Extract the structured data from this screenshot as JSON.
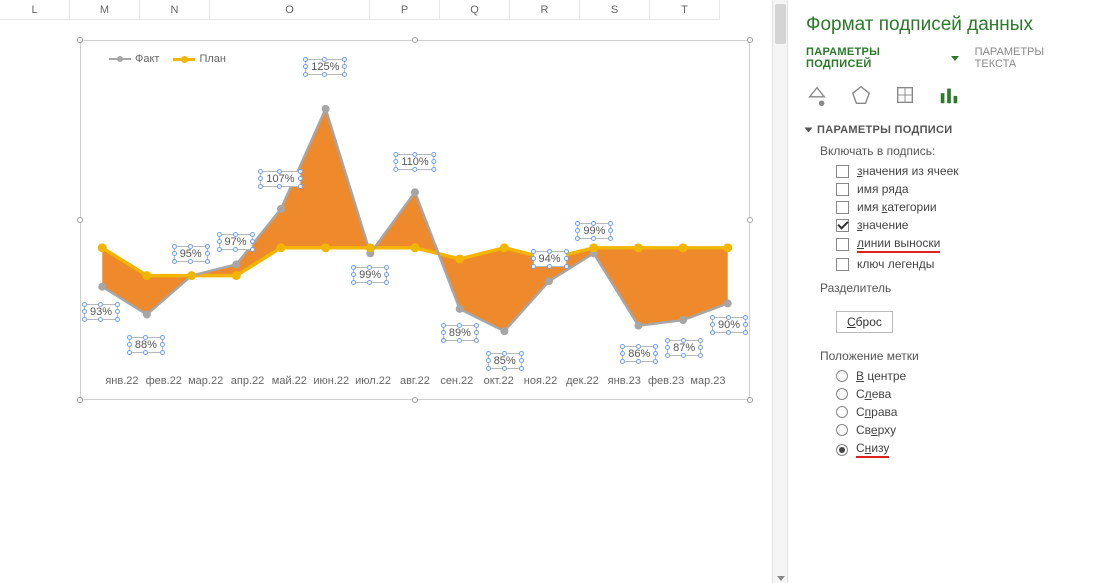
{
  "columns": [
    {
      "label": "L",
      "w": 70
    },
    {
      "label": "M",
      "w": 70
    },
    {
      "label": "N",
      "w": 70
    },
    {
      "label": "O",
      "w": 160
    },
    {
      "label": "P",
      "w": 70
    },
    {
      "label": "Q",
      "w": 70
    },
    {
      "label": "R",
      "w": 70
    },
    {
      "label": "S",
      "w": 70
    },
    {
      "label": "T",
      "w": 70
    }
  ],
  "chart_data": {
    "type": "line",
    "title": "",
    "ylabel": "",
    "xlabel": "",
    "categories": [
      "янв.22",
      "фев.22",
      "мар.22",
      "апр.22",
      "май.22",
      "июн.22",
      "июл.22",
      "авг.22",
      "сен.22",
      "окт.22",
      "ноя.22",
      "дек.22",
      "янв.23",
      "фев.23",
      "мар.23"
    ],
    "series": [
      {
        "name": "Факт",
        "color": "#a6a6a6",
        "values": [
          93,
          88,
          95,
          97,
          107,
          125,
          99,
          110,
          89,
          85,
          94,
          99,
          86,
          87,
          90
        ]
      },
      {
        "name": "План",
        "color": "#f2b600",
        "values": [
          100,
          95,
          95,
          95,
          100,
          100,
          100,
          100,
          98,
          100,
          98,
          100,
          100,
          100,
          100
        ]
      }
    ],
    "fill_between": true,
    "fill_color": "#ee8a2c",
    "ylim": [
      80,
      130
    ],
    "legend_position": "top-left",
    "data_labels": {
      "series": "Факт",
      "format": "{v}%",
      "position": "below"
    }
  },
  "legend": {
    "fact": "Факт",
    "plan": "План"
  },
  "labels": [
    "93%",
    "88%",
    "95%",
    "97%",
    "107%",
    "125%",
    "99%",
    "110%",
    "89%",
    "85%",
    "94%",
    "99%",
    "86%",
    "87%",
    "90%"
  ],
  "side": {
    "title": "Формат подписей данных",
    "tab_active": "ПАРАМЕТРЫ ПОДПИСЕЙ",
    "tab_inactive": "ПАРАМЕТРЫ ТЕКСТА",
    "section": "ПАРАМЕТРЫ ПОДПИСИ",
    "include_label": "Включать в подпись:",
    "options": {
      "from_cells": "значения из ячеек",
      "series_name": "имя ряда",
      "category_name": "имя категории",
      "value": "значение",
      "leader_lines": "линии выноски",
      "legend_key": "ключ легенды"
    },
    "separator_label": "Разделитель",
    "reset": "Сброс",
    "position_label": "Положение метки",
    "positions": {
      "center": "В центре",
      "left": "Слева",
      "right": "Справа",
      "above": "Сверху",
      "below": "Снизу"
    }
  }
}
